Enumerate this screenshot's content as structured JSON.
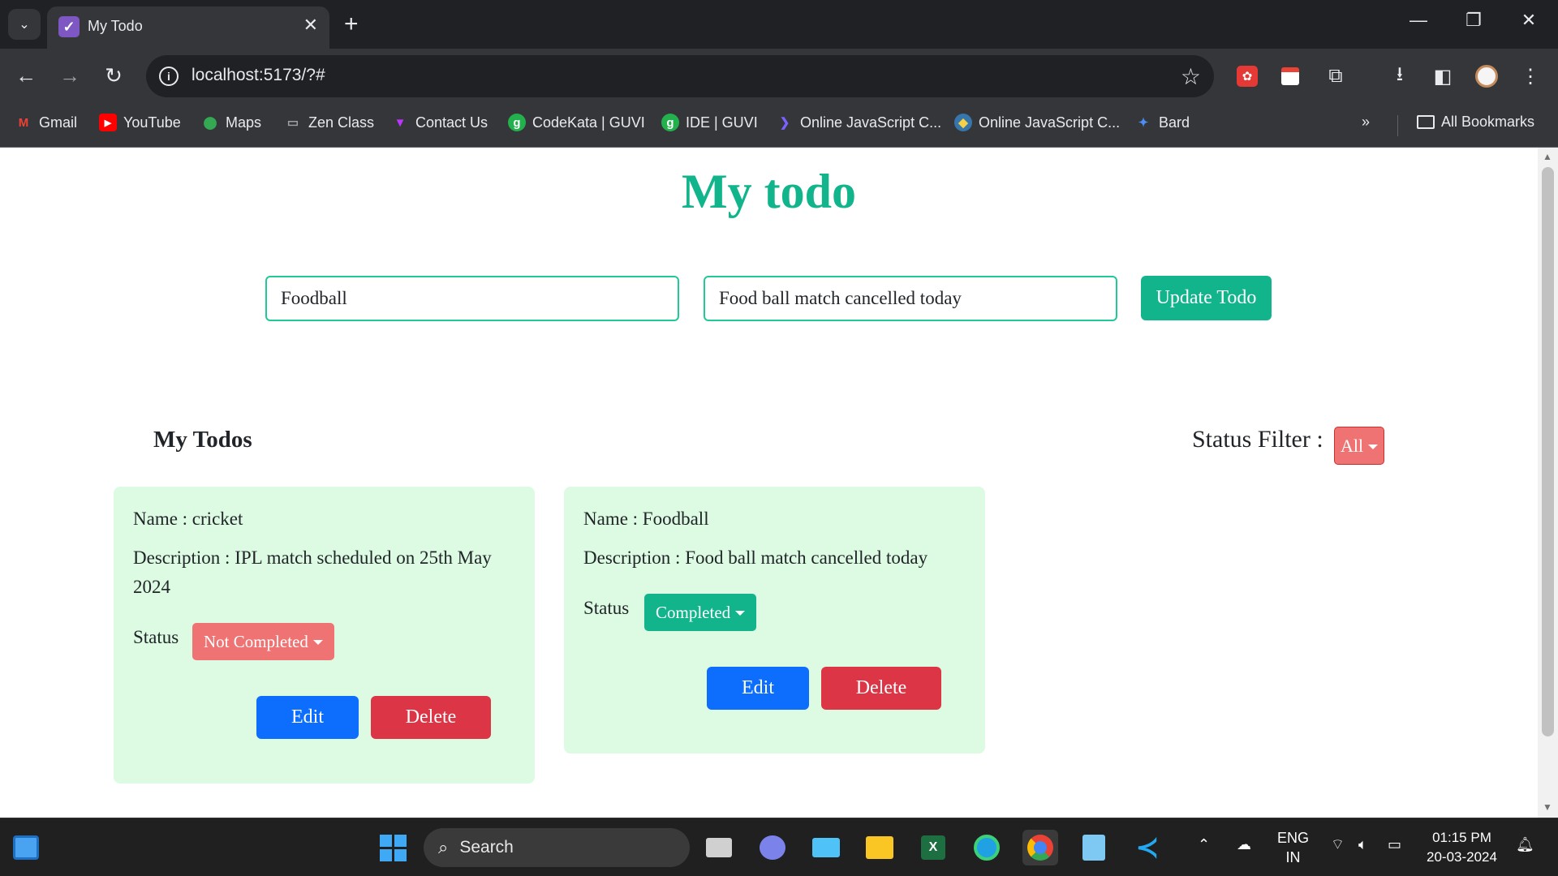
{
  "browser": {
    "tab_title": "My Todo",
    "url": "localhost:5173/?#",
    "bookmarks": [
      {
        "label": "Gmail",
        "icon": "gmail-icon",
        "glyph": "M",
        "color": "#ea4335",
        "bg": "transparent"
      },
      {
        "label": "YouTube",
        "icon": "youtube-icon",
        "glyph": "▶",
        "color": "#ffffff",
        "bg": "#ff0000"
      },
      {
        "label": "Maps",
        "icon": "maps-icon",
        "glyph": "⬤",
        "color": "#34a853",
        "bg": "transparent"
      },
      {
        "label": "Zen Class",
        "icon": "zen-class-icon",
        "glyph": "▭",
        "color": "#9aa0a6",
        "bg": "transparent"
      },
      {
        "label": "Contact Us",
        "icon": "vite-icon",
        "glyph": "▼",
        "color": "#bd34fe",
        "bg": "transparent"
      },
      {
        "label": "CodeKata | GUVI",
        "icon": "guvi-icon",
        "glyph": "g",
        "color": "#ffffff",
        "bg": "#22b14c"
      },
      {
        "label": "IDE | GUVI",
        "icon": "guvi-icon",
        "glyph": "g",
        "color": "#ffffff",
        "bg": "#22b14c"
      },
      {
        "label": "Online JavaScript C...",
        "icon": "programiz-icon",
        "glyph": "❯",
        "color": "#7b61ff",
        "bg": "transparent"
      },
      {
        "label": "Online JavaScript C...",
        "icon": "python-icon",
        "glyph": "◆",
        "color": "#f7d046",
        "bg": "#3776ab"
      },
      {
        "label": "Bard",
        "icon": "bard-icon",
        "glyph": "✦",
        "color": "#4c8df6",
        "bg": "transparent"
      }
    ],
    "all_bookmarks_label": "All Bookmarks"
  },
  "app": {
    "title": "My todo",
    "name_input_value": "Foodball",
    "description_input_value": "Food ball match cancelled today",
    "update_button_label": "Update Todo",
    "section_title": "My Todos",
    "filter_label": "Status Filter :",
    "filter_value": "All",
    "todos": [
      {
        "name": "Name : cricket",
        "description": "Description : IPL match scheduled on 25th May 2024",
        "status_label": "Status",
        "status_value": "Not Completed",
        "edit_label": "Edit",
        "delete_label": "Delete"
      },
      {
        "name": "Name : Foodball",
        "description": "Description : Food ball match cancelled today",
        "status_label": "Status",
        "status_value": "Completed",
        "edit_label": "Edit",
        "delete_label": "Delete"
      }
    ]
  },
  "taskbar": {
    "search_label": "Search",
    "language_line1": "ENG",
    "language_line2": "IN",
    "time": "01:15 PM",
    "date": "20-03-2024"
  },
  "colors": {
    "accent_teal": "#12b48c",
    "card_bg": "#dcfbe2",
    "edit_blue": "#0d6efd",
    "delete_red": "#dc3545",
    "not_completed_red": "#ef7373"
  }
}
